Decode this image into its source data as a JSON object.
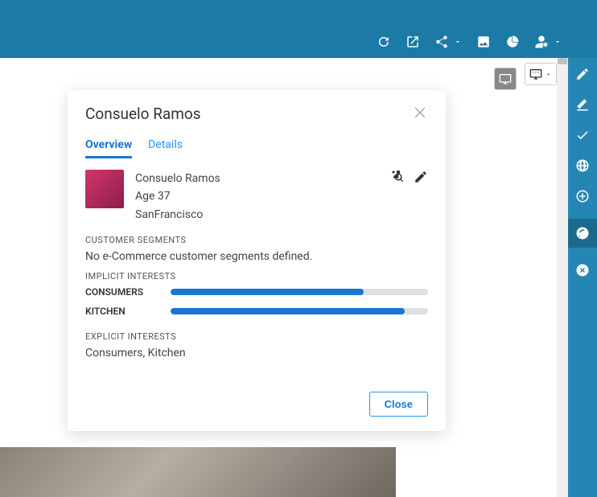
{
  "modal": {
    "title": "Consuelo Ramos",
    "tabs": {
      "overview": "Overview",
      "details": "Details"
    },
    "profile": {
      "name": "Consuelo Ramos",
      "age": "Age 37",
      "location": "SanFrancisco"
    },
    "segments": {
      "label": "CUSTOMER SEGMENTS",
      "text": "No e-Commerce customer segments defined."
    },
    "implicit": {
      "label": "IMPLICIT INTERESTS",
      "items": [
        {
          "name": "CONSUMERS",
          "pct": 75
        },
        {
          "name": "KITCHEN",
          "pct": 91
        }
      ]
    },
    "explicit": {
      "label": "EXPLICIT INTERESTS",
      "text": "Consumers, Kitchen"
    },
    "closeBtn": "Close"
  }
}
